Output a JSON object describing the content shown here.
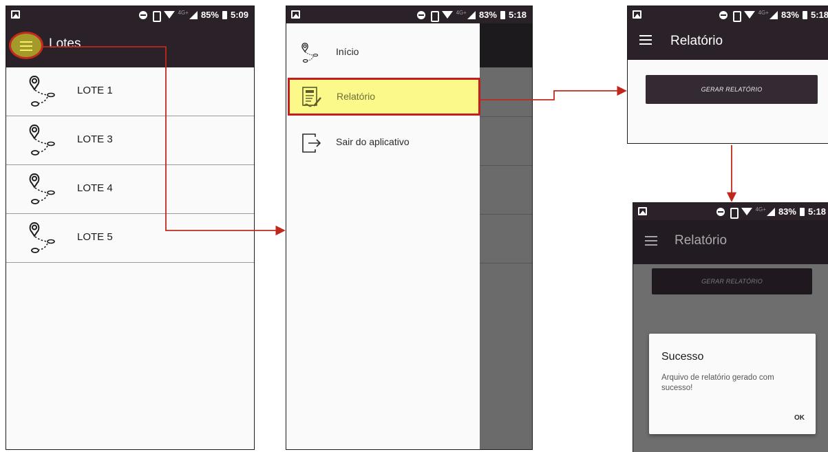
{
  "screen1": {
    "status": {
      "battery": "85%",
      "time": "5:09",
      "network": "4G+"
    },
    "title": "Lotes",
    "lotes": [
      {
        "label": "LOTE 1"
      },
      {
        "label": "LOTE 3"
      },
      {
        "label": "LOTE 4"
      },
      {
        "label": "LOTE 5"
      }
    ]
  },
  "screen2": {
    "status": {
      "battery": "83%",
      "time": "5:18",
      "network": "4G+"
    },
    "menu": [
      {
        "label": "Início",
        "icon": "route-pin-icon"
      },
      {
        "label": "Relatório",
        "icon": "report-icon",
        "selected": true
      },
      {
        "label": "Sair do aplicativo",
        "icon": "exit-icon"
      }
    ]
  },
  "screen3": {
    "status": {
      "battery": "83%",
      "time": "5:18",
      "network": "4G+"
    },
    "title": "Relatório",
    "button_label": "GERAR RELATÓRIO"
  },
  "screen4": {
    "status": {
      "battery": "83%",
      "time": "5:18",
      "network": "4G+"
    },
    "title": "Relatório",
    "button_label": "GERAR RELATÓRIO",
    "dialog": {
      "title": "Sucesso",
      "message": "Arquivo de relatório gerado com sucesso!",
      "ok_label": "OK"
    }
  },
  "colors": {
    "appbar": "#2a2129",
    "highlight_fill": "#faf98a",
    "highlight_border": "#c31d1d",
    "arrow": "#c0281c"
  }
}
